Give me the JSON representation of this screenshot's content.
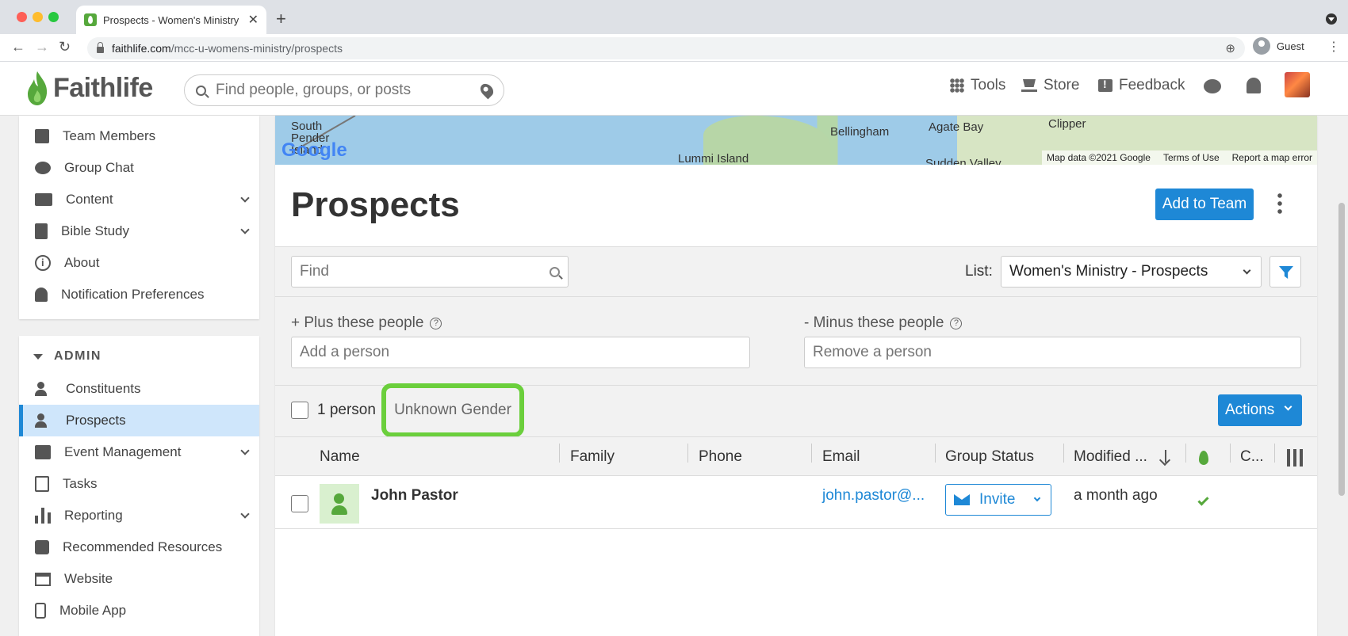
{
  "browser": {
    "tab_title": "Prospects - Women's Ministry",
    "url_domain": "faithlife.com",
    "url_path": "/mcc-u-womens-ministry/prospects",
    "profile_label": "Guest"
  },
  "header": {
    "logo_text": "Faithlife",
    "search_placeholder": "Find people, groups, or posts",
    "nav": [
      "Tools",
      "Store",
      "Feedback"
    ]
  },
  "sidebar": {
    "items": [
      {
        "label": "Team Members",
        "icon": "team-icon"
      },
      {
        "label": "Group Chat",
        "icon": "chat-icon"
      },
      {
        "label": "Content",
        "icon": "folder-icon",
        "expandable": true
      },
      {
        "label": "Bible Study",
        "icon": "bible-icon",
        "expandable": true
      },
      {
        "label": "About",
        "icon": "info-icon"
      },
      {
        "label": "Notification Preferences",
        "icon": "bell-icon"
      }
    ],
    "admin_label": "ADMIN",
    "admin_items": [
      {
        "label": "Constituents",
        "icon": "constituents-icon"
      },
      {
        "label": "Prospects",
        "icon": "prospects-icon",
        "active": true
      },
      {
        "label": "Event Management",
        "icon": "calendar-icon",
        "expandable": true
      },
      {
        "label": "Tasks",
        "icon": "tasks-icon"
      },
      {
        "label": "Reporting",
        "icon": "chart-icon",
        "expandable": true
      },
      {
        "label": "Recommended Resources",
        "icon": "resources-icon"
      },
      {
        "label": "Website",
        "icon": "website-icon"
      },
      {
        "label": "Mobile App",
        "icon": "mobile-icon"
      }
    ]
  },
  "map": {
    "labels": [
      "South Pender Island",
      "Bellingham",
      "Agate Bay",
      "Clipper",
      "Lummi Island",
      "Sudden Valley"
    ],
    "attribution": "Google",
    "footer": [
      "Map data ©2021 Google",
      "Terms of Use",
      "Report a map error"
    ]
  },
  "main": {
    "title": "Prospects",
    "add_button": "Add to Team",
    "find_placeholder": "Find",
    "list_label": "List:",
    "list_value": "Women's Ministry - Prospects",
    "plus_label": "+ Plus these people",
    "plus_placeholder": "Add a person",
    "minus_label": "- Minus these people",
    "minus_placeholder": "Remove a person",
    "count": "1 person",
    "gender_filter": "Unknown Gender",
    "actions_label": "Actions"
  },
  "table": {
    "columns": [
      "Name",
      "Family",
      "Phone",
      "Email",
      "Group Status",
      "Modified ...",
      "C..."
    ],
    "rows": [
      {
        "name": "John Pastor",
        "family": "",
        "phone": "",
        "email": "john.pastor@...",
        "status": "Invite",
        "modified": "a month ago",
        "faithlife_member": true
      }
    ]
  },
  "colors": {
    "accent": "#1e88d6",
    "brand_green": "#56a83c",
    "highlight": "#6bcf3c"
  }
}
